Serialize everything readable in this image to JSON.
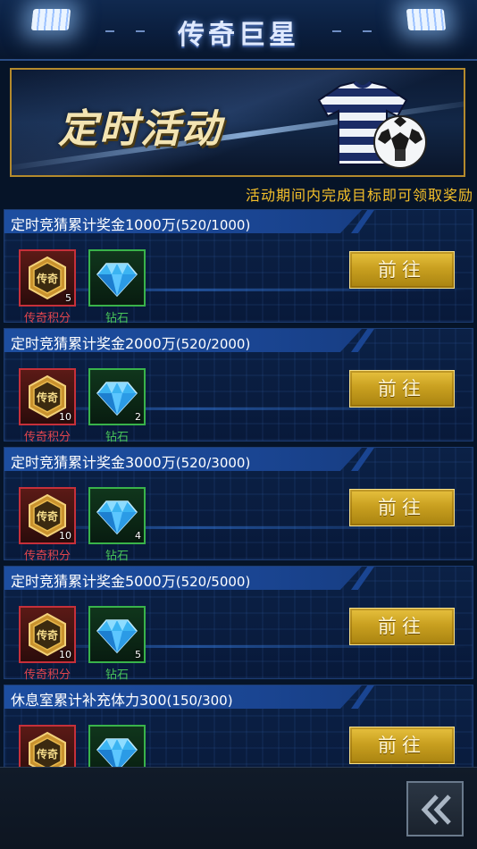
{
  "header": {
    "title": "传奇巨星"
  },
  "banner": {
    "label": "定时活动"
  },
  "hint": "活动期间内完成目标即可领取奖励",
  "tasks": [
    {
      "title": "定时竞猜累计奖金1000万",
      "progress": "(520/1000)",
      "legend_count": "5",
      "diamond_count": "",
      "legend_label": "传奇积分",
      "diamond_label": "钻石",
      "button": "前往"
    },
    {
      "title": "定时竞猜累计奖金2000万",
      "progress": "(520/2000)",
      "legend_count": "10",
      "diamond_count": "2",
      "legend_label": "传奇积分",
      "diamond_label": "钻石",
      "button": "前往"
    },
    {
      "title": "定时竞猜累计奖金3000万",
      "progress": "(520/3000)",
      "legend_count": "10",
      "diamond_count": "4",
      "legend_label": "传奇积分",
      "diamond_label": "钻石",
      "button": "前往"
    },
    {
      "title": "定时竞猜累计奖金5000万",
      "progress": "(520/5000)",
      "legend_count": "10",
      "diamond_count": "5",
      "legend_label": "传奇积分",
      "diamond_label": "钻石",
      "button": "前往"
    },
    {
      "title": "休息室累计补充体力300",
      "progress": "(150/300)",
      "legend_count": "",
      "diamond_count": "",
      "legend_label": "",
      "diamond_label": "",
      "button": "前往"
    }
  ],
  "legend_badge_text": "传奇",
  "icons": {
    "legend": "legend-points-icon",
    "diamond": "diamond-icon",
    "back": "double-chevron-left-icon"
  },
  "colors": {
    "gold_button": "#c9a020",
    "legend_border": "#c6303a",
    "diamond_border": "#39b34a",
    "hint": "#f5c02a"
  }
}
